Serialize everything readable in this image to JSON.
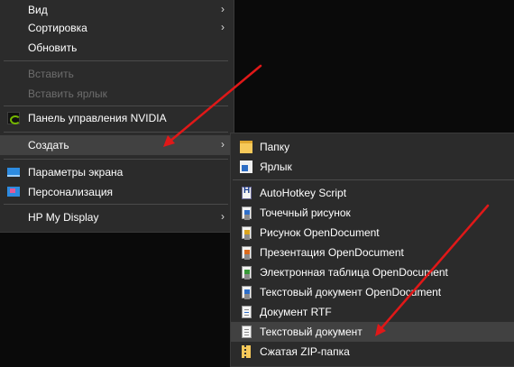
{
  "context_menu": {
    "items": [
      {
        "label": "Вид",
        "submenu": true,
        "disabled": false
      },
      {
        "label": "Сортировка",
        "submenu": true,
        "disabled": false
      },
      {
        "label": "Обновить",
        "submenu": false,
        "disabled": false
      },
      {
        "label": "Вставить",
        "submenu": false,
        "disabled": true
      },
      {
        "label": "Вставить ярлык",
        "submenu": false,
        "disabled": true
      },
      {
        "label": "Панель управления NVIDIA",
        "icon": "nvidia-icon",
        "submenu": false,
        "disabled": false
      },
      {
        "label": "Создать",
        "submenu": true,
        "disabled": false,
        "highlighted": true
      },
      {
        "label": "Параметры экрана",
        "icon": "display-settings-icon",
        "submenu": false,
        "disabled": false
      },
      {
        "label": "Персонализация",
        "icon": "personalization-icon",
        "submenu": false,
        "disabled": false
      },
      {
        "label": "HP My Display",
        "submenu": true,
        "disabled": false
      }
    ]
  },
  "create_submenu": {
    "items": [
      {
        "label": "Папку",
        "icon": "folder-icon"
      },
      {
        "label": "Ярлык",
        "icon": "shortcut-icon"
      },
      {
        "label": "AutoHotkey Script",
        "icon": "autohotkey-icon"
      },
      {
        "label": "Точечный рисунок",
        "icon": "bitmap-icon"
      },
      {
        "label": "Рисунок OpenDocument",
        "icon": "opendocument-drawing-icon"
      },
      {
        "label": "Презентация OpenDocument",
        "icon": "opendocument-presentation-icon"
      },
      {
        "label": "Электронная таблица OpenDocument",
        "icon": "opendocument-spreadsheet-icon"
      },
      {
        "label": "Текстовый документ OpenDocument",
        "icon": "opendocument-text-icon"
      },
      {
        "label": "Документ RTF",
        "icon": "rtf-document-icon"
      },
      {
        "label": "Текстовый документ",
        "icon": "text-document-icon",
        "highlighted": true
      },
      {
        "label": "Сжатая ZIP-папка",
        "icon": "zip-folder-icon"
      }
    ]
  },
  "annotation_color": "#e01818",
  "chevron": "›"
}
